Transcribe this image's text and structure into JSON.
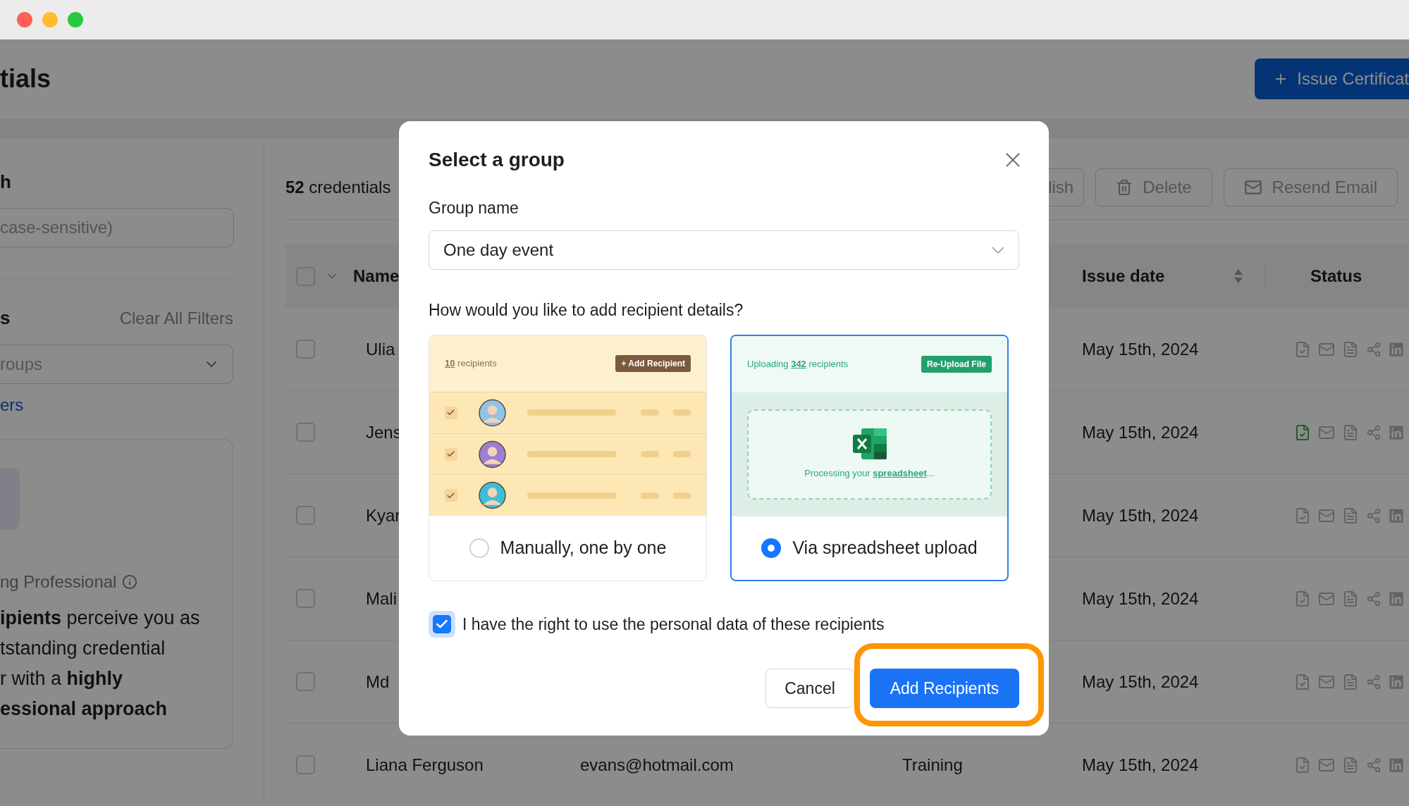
{
  "page": {
    "title": "tials",
    "primary_action": "Issue Certificat"
  },
  "sidebar": {
    "search": {
      "label": "h",
      "placeholder": "case-sensitive)"
    },
    "filters": {
      "label": "s",
      "clear": "Clear All Filters",
      "group_select": {
        "placeholder": "roups"
      },
      "link": "ers"
    },
    "promo": {
      "title": "ng Professional",
      "lines": [
        "**ipients** perceive you as",
        "tstanding credential",
        "r with a **highly**",
        "**essional approach**"
      ]
    }
  },
  "table": {
    "count": "**52** credentials",
    "actions": [
      {
        "kind": "plain",
        "label": "lish"
      },
      {
        "kind": "delete",
        "label": "Delete"
      },
      {
        "kind": "email",
        "label": "Resend Email"
      }
    ],
    "columns": [
      "Name",
      "Issue date",
      "Status"
    ],
    "rows": [
      {
        "checked": false,
        "name": "Ulia",
        "date": "May 15th, 2024",
        "verified": false
      },
      {
        "checked": false,
        "name": "Jens",
        "date": "May 15th, 2024",
        "verified": true
      },
      {
        "checked": false,
        "name": "Kyar",
        "date": "May 15th, 2024",
        "verified": false
      },
      {
        "checked": false,
        "name": "Mali",
        "date": "May 15th, 2024",
        "verified": false
      },
      {
        "checked": false,
        "name": "Md",
        "date": "May 15th, 2024",
        "verified": false
      },
      {
        "checked": false,
        "name": "Liana Ferguson",
        "email": "evans@hotmail.com",
        "column_3": "Training",
        "date": "May 15th, 2024",
        "verified": false
      }
    ],
    "select_all": {
      "checked": false
    }
  },
  "modal": {
    "title": "Select a group",
    "group_field": {
      "label": "Group name",
      "value": "One day event"
    },
    "question": "How would you like to add recipient details?",
    "options": [
      {
        "kind": "manual",
        "label": "Manually, one by one",
        "selected": false,
        "preview": {
          "count_text": "**10** recipients",
          "button": "+ Add Recipient",
          "rows": [
            {
              "checked": true,
              "color": "#8fc3e8"
            },
            {
              "checked": true,
              "color": "#9b7fd1"
            },
            {
              "checked": true,
              "color": "#3cbfd6"
            }
          ]
        }
      },
      {
        "kind": "spreadsheet",
        "label": "Via spreadsheet upload",
        "selected": true,
        "preview": {
          "status_text": "Uploading **342** recipients",
          "button": "Re-Upload File",
          "message": "Processing your **spreadsheet**..."
        }
      }
    ],
    "consent": {
      "label": "I have the right to use the personal data of these recipients",
      "checked": true
    },
    "buttons": [
      {
        "kind": "secondary",
        "label": "Cancel",
        "highlighted": false
      },
      {
        "kind": "primary",
        "label": "Add Recipients",
        "highlighted": true
      }
    ]
  }
}
